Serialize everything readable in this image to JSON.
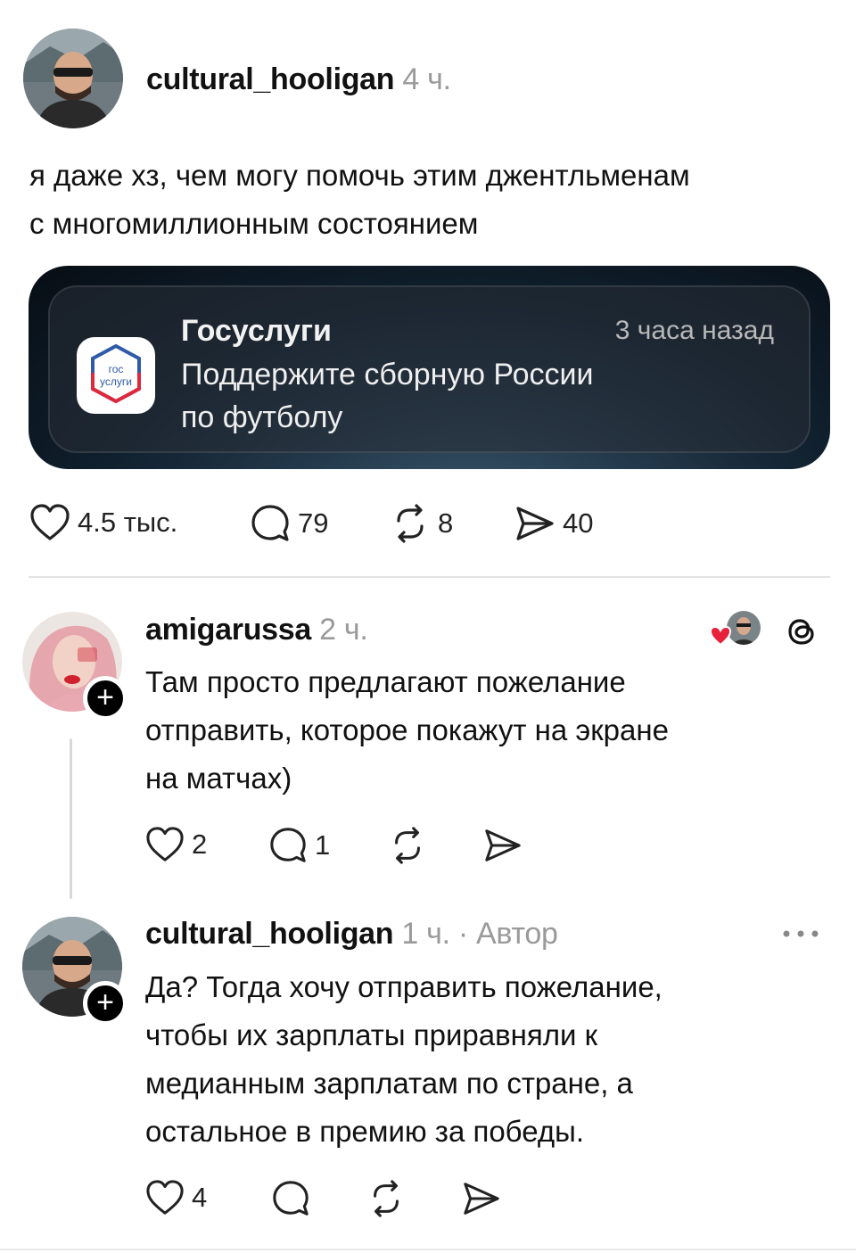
{
  "post": {
    "username": "cultural_hooligan",
    "time": "4 ч.",
    "text_line1": "я даже хз, чем могу помочь этим джентльменам",
    "text_line2": "с многомиллионным состоянием",
    "notification": {
      "app_name": "Госуслуги",
      "time": "3 часа назад",
      "body_line1": "Поддержите сборную России",
      "body_line2": "по футболу",
      "icon_text_top": "гос",
      "icon_text_bottom": "услуги"
    },
    "actions": {
      "likes": "4.5 тыс.",
      "comments": "79",
      "reposts": "8",
      "shares": "40"
    }
  },
  "replies": [
    {
      "username": "amigarussa",
      "time": "2 ч.",
      "lines": [
        "Там просто предлагают пожелание",
        "отправить, которое покажут на экране",
        "на матчах)"
      ],
      "likes": "2",
      "comments": "1"
    },
    {
      "username": "cultural_hooligan",
      "time": "1 ч. · Автор",
      "lines": [
        "Да? Тогда хочу отправить пожелание,",
        "чтобы их зарплаты приравняли к",
        "медианным зарплатам по стране, а",
        "остальное в премию за победы."
      ],
      "likes": "4"
    }
  ],
  "colors": {
    "heart_red": "#e8213c",
    "muted": "#9a9a9a",
    "icon_gray": "#222222",
    "gosuslugi_red": "#e0283c",
    "gosuslugi_blue": "#2f5aa8"
  },
  "icons": [
    "heart-icon",
    "comment-icon",
    "repost-icon",
    "share-icon",
    "threads-logo-icon",
    "more-icon",
    "plus-icon"
  ]
}
